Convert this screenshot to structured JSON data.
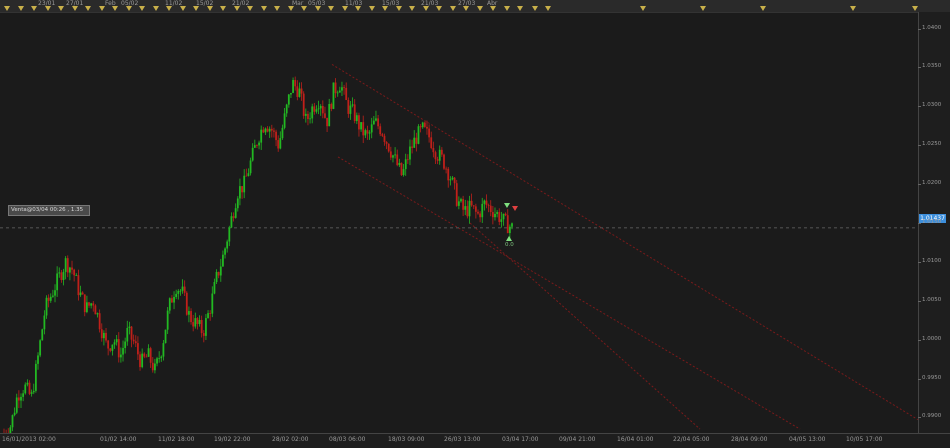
{
  "top_axis": {
    "labels": [
      "23/01",
      "27/01",
      "Feb",
      "05/02",
      "11/02",
      "15/02",
      "21/02",
      "Mar",
      "05/03",
      "11/03",
      "15/03",
      "21/03",
      "27/03",
      "Abr"
    ]
  },
  "price_axis": {
    "ticks": [
      "1.0400",
      "1.0350",
      "1.0300",
      "1.0250",
      "1.0200",
      "1.0150",
      "1.0100",
      "1.0050",
      "1.0000",
      "0.9950",
      "0.9900"
    ],
    "current_price": "1.01437"
  },
  "time_axis": {
    "ticks": [
      "16/01/2013 02:00",
      "01/02 14:00",
      "11/02 18:00",
      "19/02 22:00",
      "28/02 02:00",
      "08/03 06:00",
      "18/03 09:00",
      "26/03 13:00",
      "03/04 17:00",
      "09/04 21:00",
      "16/04 01:00",
      "22/04 05:00",
      "28/04 09:00",
      "04/05 13:00",
      "10/05 17:00"
    ]
  },
  "trade": {
    "label": "Venta@03/04 00:26 , 1.35",
    "pl_text": "0.0"
  },
  "colors": {
    "bull": "#22b922",
    "bear": "#c0201a",
    "channel": "#7a1a1a",
    "price_line": "#3d8fdc"
  },
  "chart_data": {
    "type": "candlestick",
    "ylim": [
      0.988,
      1.042
    ],
    "price_levels": [
      1.04,
      1.035,
      1.03,
      1.025,
      1.02,
      1.015,
      1.01,
      1.005,
      1.0,
      0.995,
      0.99
    ],
    "close_path": [
      0.988,
      0.989,
      0.993,
      0.994,
      0.9925,
      0.998,
      1.004,
      1.006,
      1.008,
      1.01,
      1.009,
      1.006,
      1.004,
      1.005,
      1.002,
      0.999,
      1.0,
      0.998,
      1.001,
      0.9995,
      0.997,
      0.998,
      0.996,
      0.999,
      1.004,
      1.007,
      1.006,
      1.003,
      1.002,
      1.001,
      1.004,
      1.008,
      1.011,
      1.015,
      1.019,
      1.02,
      1.023,
      1.026,
      1.028,
      1.027,
      1.025,
      1.029,
      1.033,
      1.032,
      1.028,
      1.03,
      1.031,
      1.028,
      1.032,
      1.033,
      1.03,
      1.029,
      1.027,
      1.026,
      1.028,
      1.027,
      1.025,
      1.023,
      1.021,
      1.024,
      1.026,
      1.027,
      1.026,
      1.024,
      1.023,
      1.021,
      1.018,
      1.0165,
      1.017,
      1.016,
      1.0175,
      1.0168,
      1.016,
      1.015,
      1.0144
    ],
    "current": 1.01437
  }
}
